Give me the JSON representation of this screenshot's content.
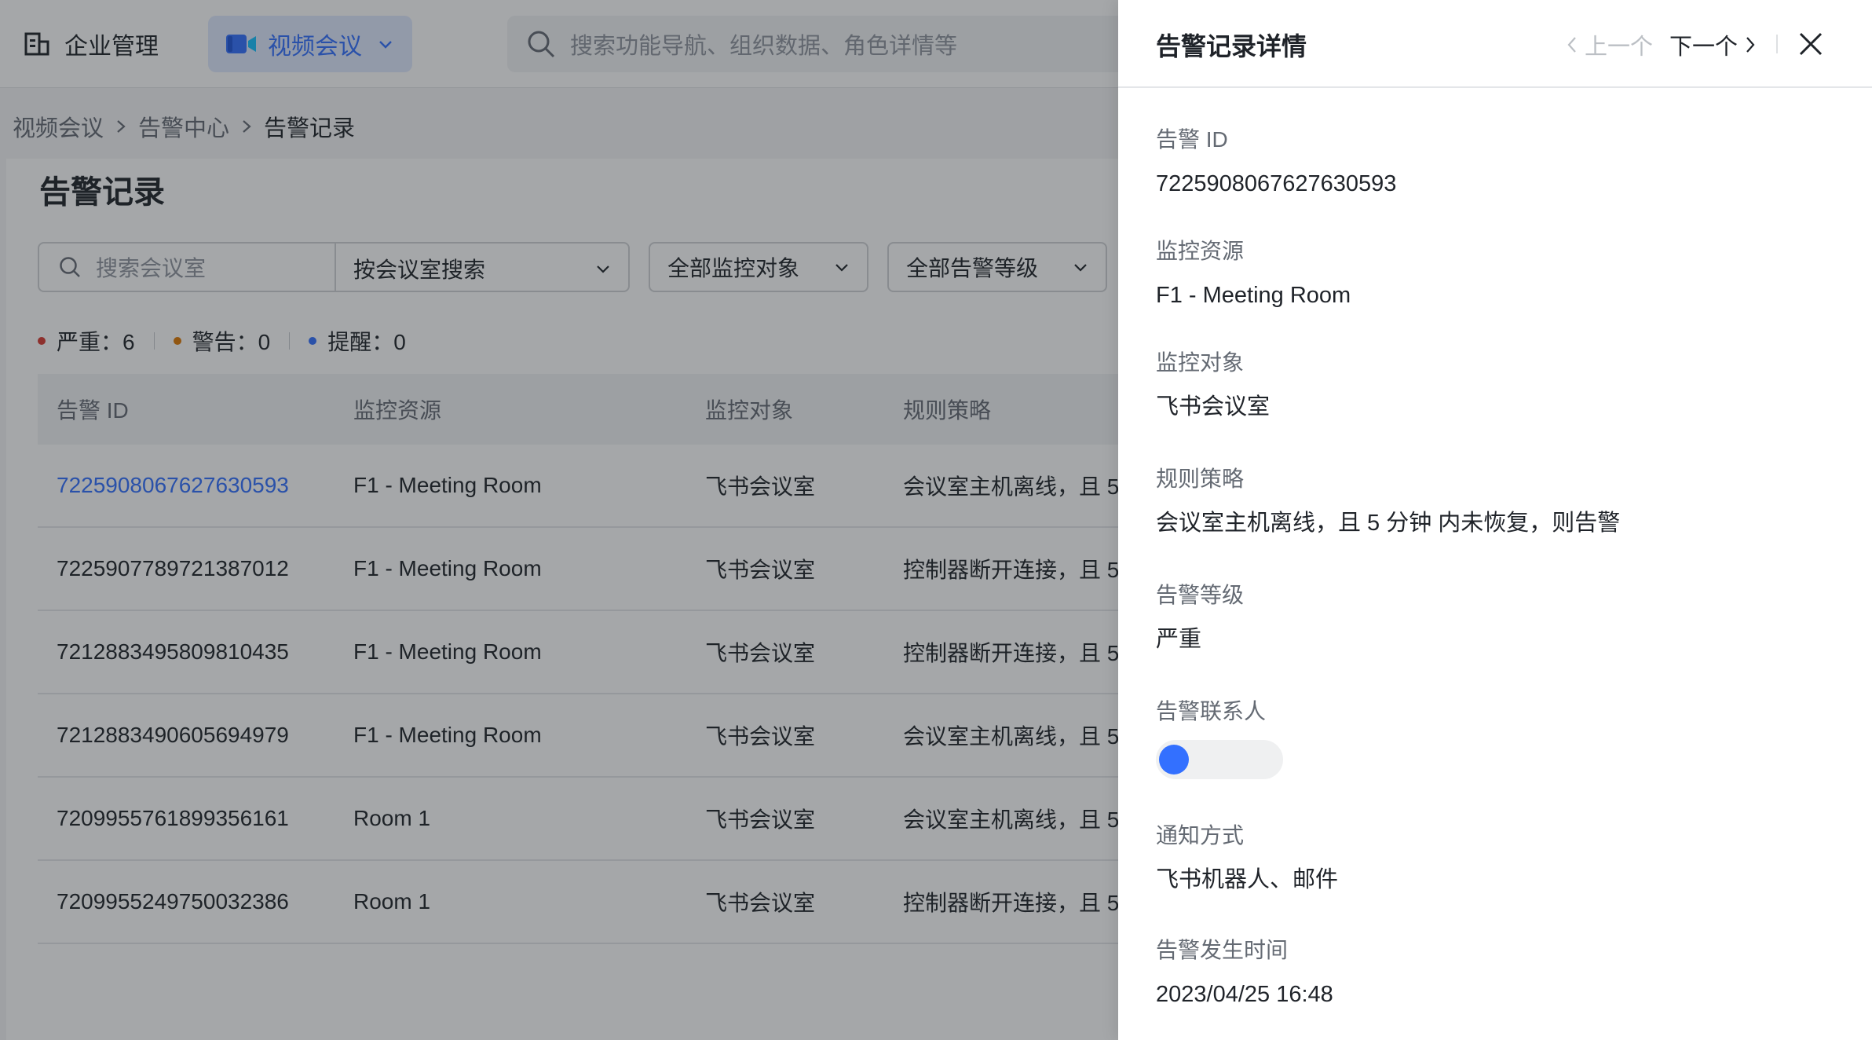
{
  "topbar": {
    "org_label": "企业管理",
    "product_label": "视频会议",
    "search_placeholder": "搜索功能导航、组织数据、角色详情等"
  },
  "breadcrumb": [
    "视频会议",
    "告警中心",
    "告警记录"
  ],
  "page_title": "告警记录",
  "filters": {
    "room_search_placeholder": "搜索会议室",
    "search_mode": "按会议室搜索",
    "monitor_object": "全部监控对象",
    "alert_level": "全部告警等级"
  },
  "stats": [
    {
      "label": "严重：",
      "count": "6",
      "color": "#d83931"
    },
    {
      "label": "警告：",
      "count": "0",
      "color": "#de7802"
    },
    {
      "label": "提醒：",
      "count": "0",
      "color": "#3370ff"
    }
  ],
  "table": {
    "headers": [
      "告警 ID",
      "监控资源",
      "监控对象",
      "规则策略"
    ],
    "rows": [
      {
        "id": "7225908067627630593",
        "resource": "F1 - Meeting Room",
        "object": "飞书会议室",
        "rule": "会议室主机离线，且 5"
      },
      {
        "id": "7225907789721387012",
        "resource": "F1 - Meeting Room",
        "object": "飞书会议室",
        "rule": "控制器断开连接，且 5"
      },
      {
        "id": "7212883495809810435",
        "resource": "F1 - Meeting Room",
        "object": "飞书会议室",
        "rule": "控制器断开连接，且 5"
      },
      {
        "id": "7212883490605694979",
        "resource": "F1 - Meeting Room",
        "object": "飞书会议室",
        "rule": "会议室主机离线，且 5"
      },
      {
        "id": "7209955761899356161",
        "resource": "Room 1",
        "object": "飞书会议室",
        "rule": "会议室主机离线，且 5"
      },
      {
        "id": "7209955249750032386",
        "resource": "Room 1",
        "object": "飞书会议室",
        "rule": "控制器断开连接，且 5"
      }
    ]
  },
  "drawer": {
    "title": "告警记录详情",
    "prev_label": "上一个",
    "next_label": "下一个",
    "fields": {
      "alert_id": {
        "label": "告警 ID",
        "value": "7225908067627630593"
      },
      "resource": {
        "label": "监控资源",
        "value": "F1 - Meeting Room"
      },
      "object": {
        "label": "监控对象",
        "value": "飞书会议室"
      },
      "rule": {
        "label": "规则策略",
        "value": "会议室主机离线，且 5 分钟 内未恢复，则告警"
      },
      "level": {
        "label": "告警等级",
        "value": "严重"
      },
      "contact": {
        "label": "告警联系人"
      },
      "notify": {
        "label": "通知方式",
        "value": "飞书机器人、邮件"
      },
      "time": {
        "label": "告警发生时间",
        "value": "2023/04/25 16:48"
      }
    }
  },
  "colors": {
    "accent": "#3370ff",
    "critical": "#d83931",
    "warning": "#de7802",
    "reminder": "#3370ff"
  }
}
